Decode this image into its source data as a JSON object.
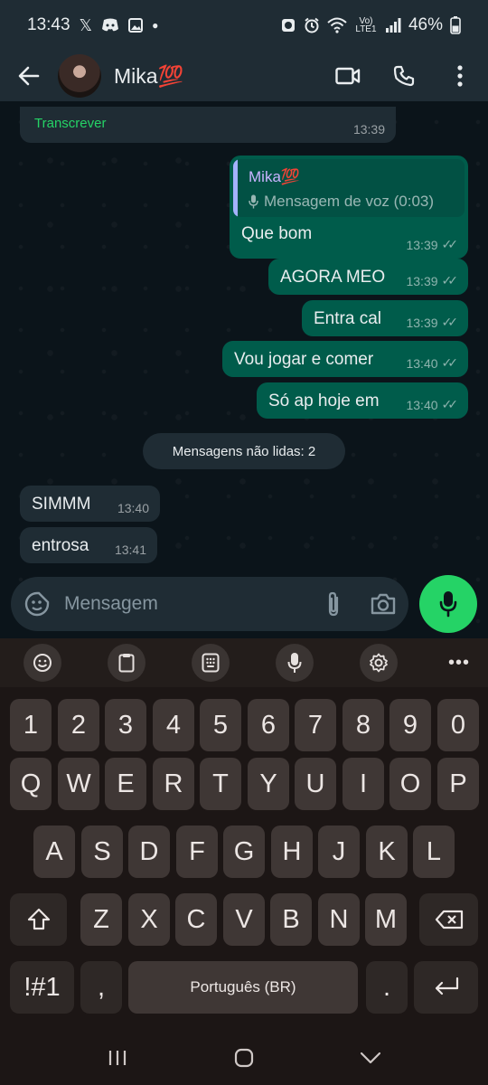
{
  "status_bar": {
    "time": "13:43",
    "network_label": "Vo) LTE1",
    "battery": "46%"
  },
  "header": {
    "contact_name": "Mika💯"
  },
  "chat": {
    "transcribe_message": {
      "action_label": "Transcrever",
      "time": "13:39"
    },
    "reply_message": {
      "quoted_name": "Mika💯",
      "quoted_text": "Mensagem de voz (0:03)",
      "text": "Que bom",
      "time": "13:39"
    },
    "outgoing": [
      {
        "text": "AGORA MEO",
        "time": "13:39"
      },
      {
        "text": "Entra cal",
        "time": "13:39"
      },
      {
        "text": "Vou jogar e comer",
        "time": "13:40"
      },
      {
        "text": "Só ap hoje em",
        "time": "13:40"
      }
    ],
    "unread_label": "Mensagens não lidas: 2",
    "incoming": [
      {
        "text": "SIMMM",
        "time": "13:40"
      },
      {
        "text": "entrosa",
        "time": "13:41"
      }
    ]
  },
  "composer": {
    "placeholder": "Mensagem"
  },
  "keyboard": {
    "number_row": [
      "1",
      "2",
      "3",
      "4",
      "5",
      "6",
      "7",
      "8",
      "9",
      "0"
    ],
    "row1": [
      "Q",
      "W",
      "E",
      "R",
      "T",
      "Y",
      "U",
      "I",
      "O",
      "P"
    ],
    "row2": [
      "A",
      "S",
      "D",
      "F",
      "G",
      "H",
      "J",
      "K",
      "L"
    ],
    "row3": [
      "Z",
      "X",
      "C",
      "V",
      "B",
      "N",
      "M"
    ],
    "symbols_key": "!#1",
    "comma_key": ",",
    "space_label": "Português (BR)",
    "period_key": ".",
    "more_label": "•••"
  },
  "colors": {
    "outgoing_bubble": "#005c4b",
    "incoming_bubble": "#1f2c34",
    "accent": "#25d366"
  }
}
